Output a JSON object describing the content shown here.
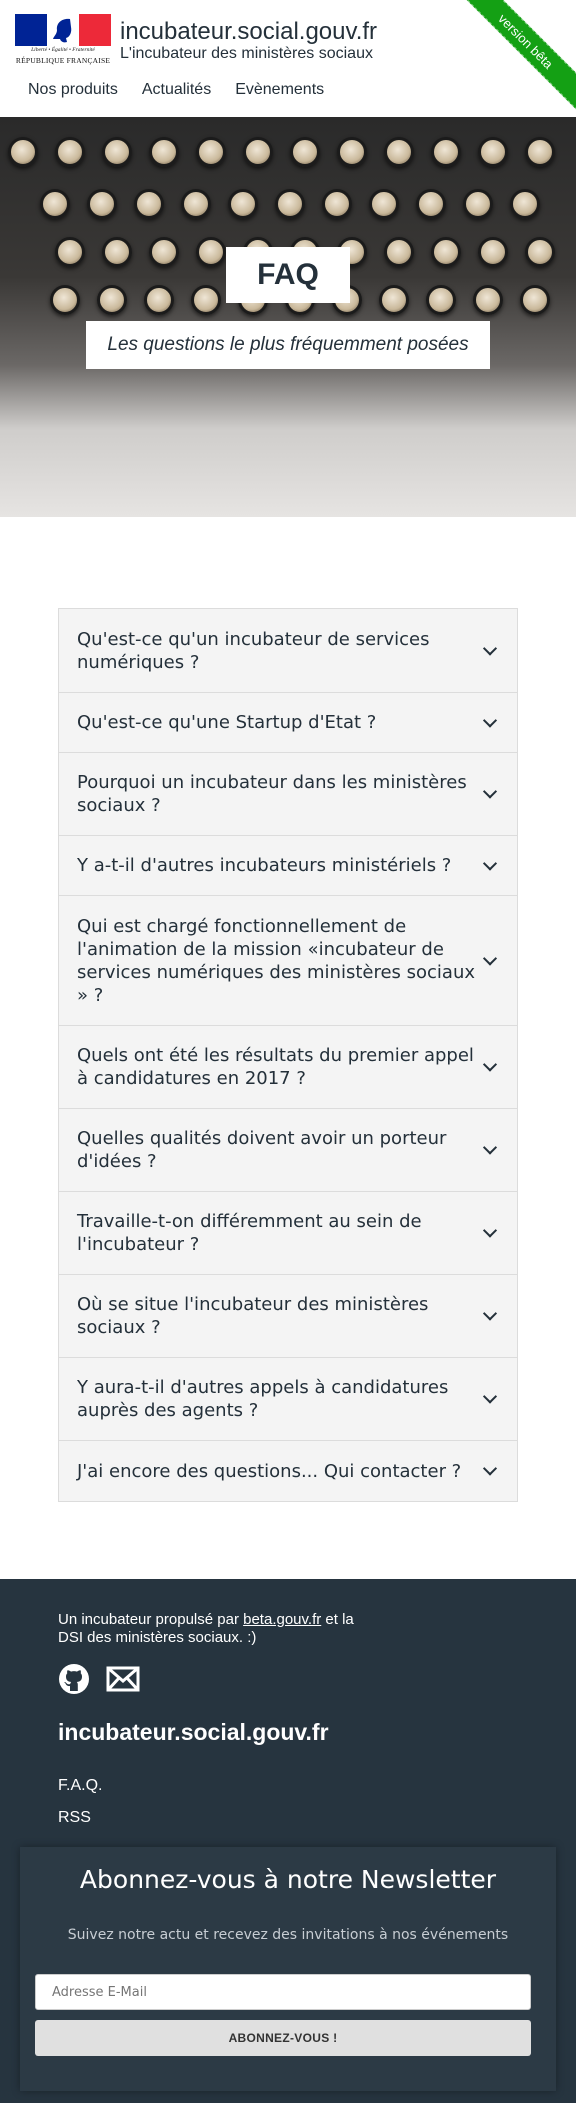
{
  "logo": {
    "motto": "Liberté • Égalité • Fraternité",
    "label": "RÉPUBLIQUE FRANÇAISE"
  },
  "header": {
    "title": "incubateur.social.gouv.fr",
    "subtitle": "L'incubateur des ministères sociaux",
    "beta_ribbon": "version bêta"
  },
  "nav": {
    "items": [
      "Nos produits",
      "Actualités",
      "Evènements"
    ]
  },
  "hero": {
    "title": "FAQ",
    "subtitle": "Les questions le plus fréquemment posées"
  },
  "faq": {
    "items": [
      "Qu'est-ce qu'un incubateur de services numériques ?",
      "Qu'est-ce qu'une Startup d'Etat ?",
      "Pourquoi un incubateur dans les ministères sociaux ?",
      "Y a-t-il d'autres incubateurs ministériels ?",
      "Qui est chargé fonctionnellement de l'animation de la mission «incubateur de services numériques des ministères sociaux » ?",
      "Quels ont été les résultats du premier appel à candidatures en 2017 ?",
      "Quelles qualités doivent avoir un porteur d'idées ?",
      "Travaille-t-on différemment au sein de l'incubateur ?",
      "Où se situe l'incubateur des ministères sociaux ?",
      "Y aura-t-il d'autres appels à candidatures auprès des agents ?",
      "J'ai encore des questions... Qui contacter ?"
    ]
  },
  "footer": {
    "text_before": "Un incubateur propulsé par ",
    "link": "beta.gouv.fr",
    "text_after": " et la DSI des ministères sociaux. :)",
    "icons": [
      "github-icon",
      "mail-icon"
    ],
    "site_title": "incubateur.social.gouv.fr",
    "links": [
      "F.A.Q.",
      "RSS"
    ]
  },
  "newsletter": {
    "title": "Abonnez-vous à notre Newsletter",
    "subtitle": "Suivez notre actu et recevez des invitations à nos événements",
    "placeholder": "Adresse E-Mail",
    "button": "ABONNEZ-VOUS !"
  }
}
